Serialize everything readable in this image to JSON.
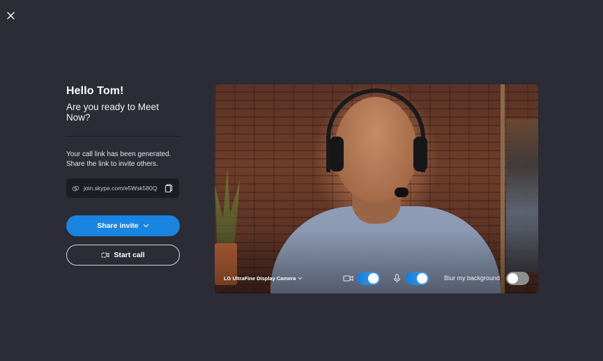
{
  "window": {
    "close_icon": "close-x-icon"
  },
  "greeting": {
    "title": "Hello  Tom!",
    "subtitle": "Are you ready to Meet Now?"
  },
  "invite": {
    "description": "Your call link has been generated. Share the link to invite others.",
    "link_icon": "link-icon",
    "link": "join.skype.com/e5Wsk580Q",
    "copy_icon": "copy-icon"
  },
  "actions": {
    "share_label": "Share invite",
    "share_icon": "chevron-down-icon",
    "start_label": "Start call",
    "start_icon": "video-camera-icon"
  },
  "preview": {
    "camera_name": "LG UltraFine Display Camera",
    "camera_chevron": "chevron-down-icon",
    "video_icon": "video-camera-icon",
    "video_enabled": true,
    "mic_icon": "microphone-icon",
    "mic_enabled": true,
    "blur_label": "Blur my background",
    "blur_enabled": false
  },
  "colors": {
    "background": "#2b2c36",
    "accent": "#1a84e1",
    "link_box": "#1c1d23"
  }
}
